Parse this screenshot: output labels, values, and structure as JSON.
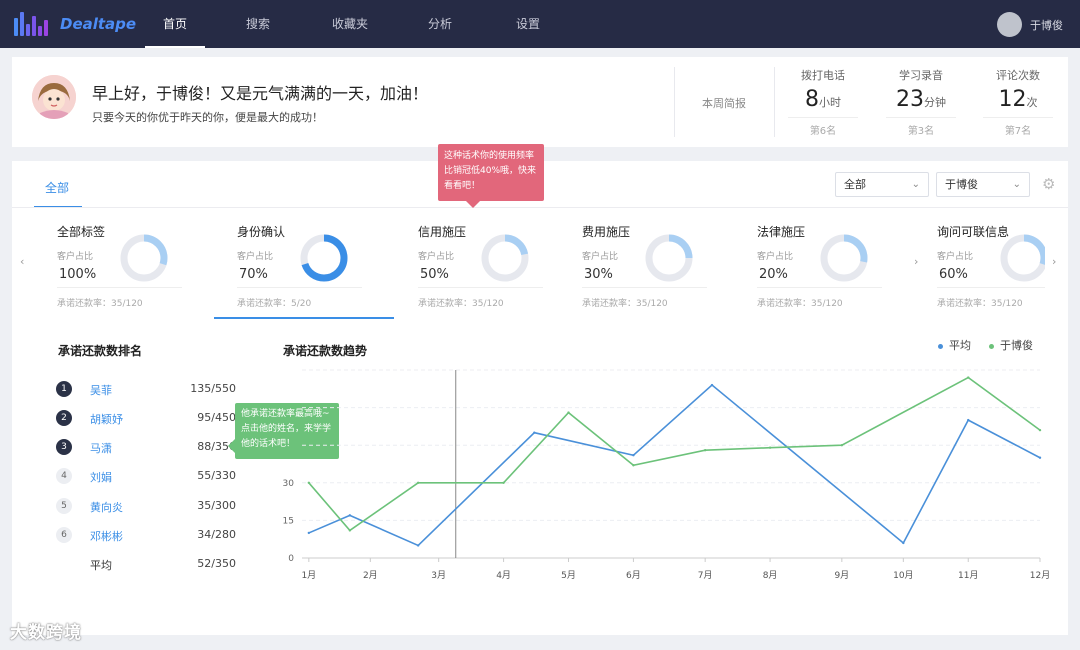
{
  "app": {
    "brand": "Dealtape"
  },
  "nav": {
    "items": [
      "首页",
      "搜索",
      "收藏夹",
      "分析",
      "设置"
    ],
    "active": 0,
    "user_name": "于博俊"
  },
  "welcome": {
    "title": "早上好，于博俊！又是元气满满的一天，加油！",
    "subtitle": "只要今天的你优于昨天的你，便是最大的成功！",
    "weekly_label": "本周简报",
    "stats": [
      {
        "label": "拨打电话",
        "value": "8",
        "unit": "小时",
        "rank": "第6名"
      },
      {
        "label": "学习录音",
        "value": "23",
        "unit": "分钟",
        "rank": "第3名"
      },
      {
        "label": "评论次数",
        "value": "12",
        "unit": "次",
        "rank": "第7名"
      }
    ]
  },
  "tabs": {
    "all_label": "全部"
  },
  "filters": {
    "scope": "全部",
    "person": "于博俊"
  },
  "tooltip_red": "这种话术你的使用频率比销冠低40%哦，快来看看吧！",
  "categories": [
    {
      "name": "全部标签",
      "sub": "客户占比",
      "percent": "100%",
      "fill": 0.3,
      "rate": "承诺还款率：35/120"
    },
    {
      "name": "身份确认",
      "sub": "客户占比",
      "percent": "70%",
      "fill": 0.7,
      "rate": "承诺还款率：5/20"
    },
    {
      "name": "信用施压",
      "sub": "客户占比",
      "percent": "50%",
      "fill": 0.22,
      "rate": "承诺还款率：35/120"
    },
    {
      "name": "费用施压",
      "sub": "客户占比",
      "percent": "30%",
      "fill": 0.25,
      "rate": "承诺还款率：35/120"
    },
    {
      "name": "法律施压",
      "sub": "客户占比",
      "percent": "20%",
      "fill": 0.28,
      "rate": "承诺还款率：35/120"
    },
    {
      "name": "询问可联信息",
      "sub": "客户占比",
      "percent": "60%",
      "fill": 0.3,
      "rate": "承诺还款率：35/120"
    }
  ],
  "carousel": {
    "prev": "‹",
    "next": "›"
  },
  "ranking": {
    "title": "承诺还款数排名",
    "rows": [
      {
        "rank": "1",
        "name": "吴菲",
        "value": "135/550"
      },
      {
        "rank": "2",
        "name": "胡颖妤",
        "value": "95/450"
      },
      {
        "rank": "3",
        "name": "马潇",
        "value": "88/350"
      },
      {
        "rank": "4",
        "name": "刘娟",
        "value": "55/330"
      },
      {
        "rank": "5",
        "name": "黄向炎",
        "value": "35/300"
      },
      {
        "rank": "6",
        "name": "邓彬彬",
        "value": "34/280"
      }
    ],
    "average": {
      "name": "平均",
      "value": "52/350"
    }
  },
  "tooltip_green": "他承诺还款率最高哦~点击他的姓名，来学学他的话术吧！",
  "colors": {
    "accent": "#3a8ee6",
    "avg_line": "#4a90d9",
    "user_line": "#6cc27a"
  },
  "watermark": "大数跨境",
  "chart_data": {
    "type": "line",
    "title": "承诺还款数趋势",
    "categories": [
      "1月",
      "2月",
      "3月",
      "4月",
      "5月",
      "6月",
      "7月",
      "8月",
      "9月",
      "10月",
      "11月",
      "12月"
    ],
    "x_positions": [
      0.1,
      1.0,
      2.0,
      2.95,
      3.9,
      4.85,
      5.9,
      6.85,
      7.9,
      8.8,
      9.75,
      10.8
    ],
    "series": [
      {
        "name": "平均",
        "x": [
          0.1,
          0.7,
          1.7,
          3.4,
          4.85,
          6.0,
          8.8,
          9.75,
          10.8
        ],
        "values": [
          10,
          17,
          5,
          50,
          41,
          69,
          6,
          55,
          40
        ]
      },
      {
        "name": "于博俊",
        "x": [
          0.1,
          0.7,
          1.7,
          2.95,
          3.9,
          4.85,
          5.9,
          6.85,
          7.9,
          9.75,
          10.8
        ],
        "values": [
          30,
          11,
          30,
          30,
          58,
          37,
          43,
          44,
          45,
          72,
          51
        ]
      }
    ],
    "y_ticks": [
      0,
      15,
      30
    ],
    "ylim": [
      0,
      75
    ],
    "xlim": [
      0,
      10.8
    ],
    "cursor_x": 2.25,
    "grid": true,
    "legend": "top-right"
  }
}
